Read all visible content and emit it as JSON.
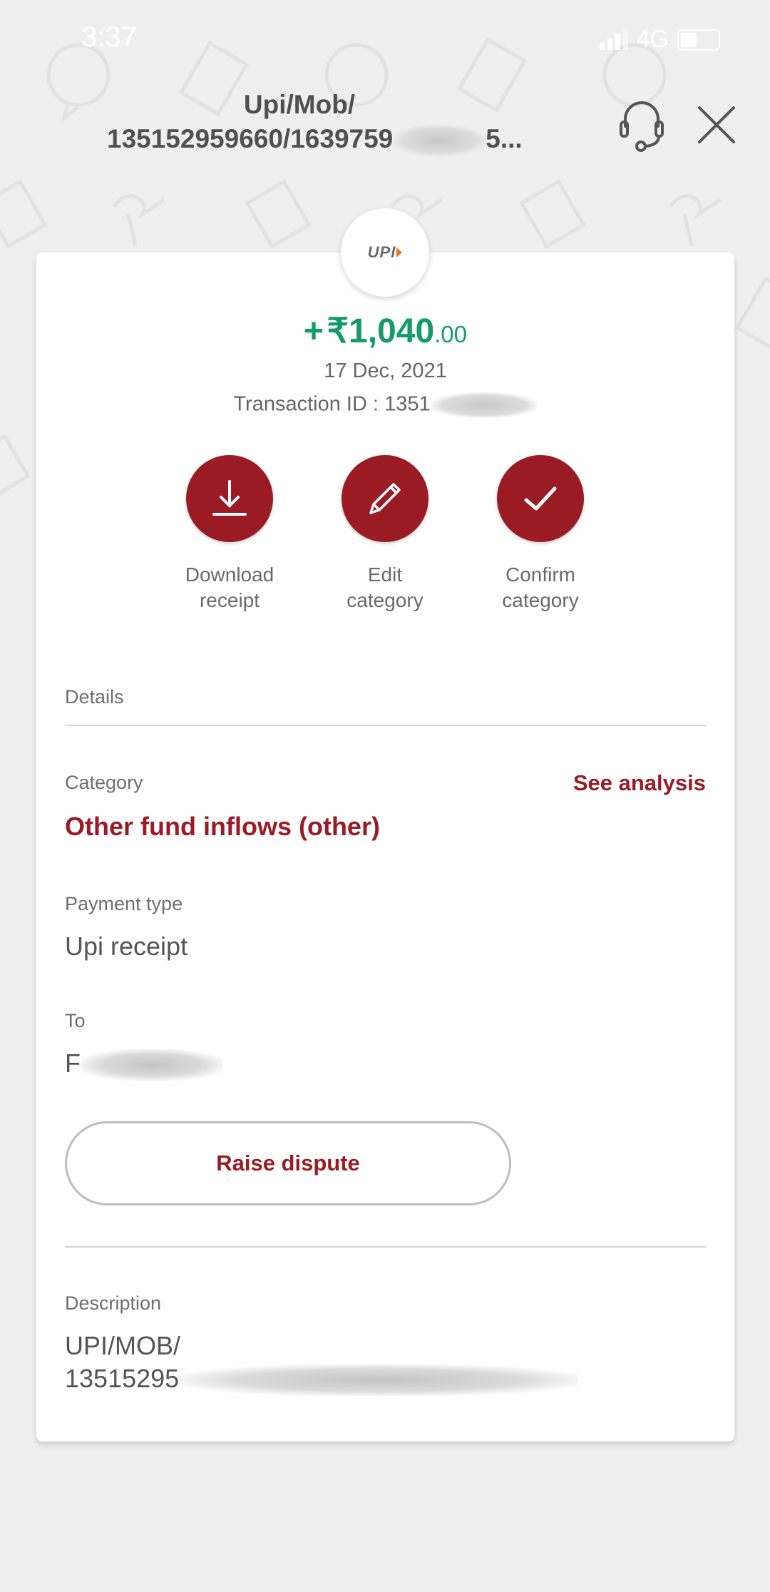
{
  "status_bar": {
    "time": "3:37",
    "network": "4G",
    "battery_level": 0.45
  },
  "header": {
    "title_line1": "Upi/Mob/",
    "title_line2_prefix": "135152959660/1639759",
    "title_line2_suffix": "5...",
    "support_icon": "headset-icon",
    "close_icon": "close-icon"
  },
  "transaction": {
    "logo_text": "UPI",
    "amount_sign": "+",
    "currency": "₹",
    "amount_main": "1,040",
    "amount_decimal": ".00",
    "date": "17 Dec, 2021",
    "transaction_id_label": "Transaction ID : ",
    "transaction_id_visible": "1351"
  },
  "actions": [
    {
      "label_line1": "Download",
      "label_line2": "receipt",
      "icon": "download-icon"
    },
    {
      "label_line1": "Edit",
      "label_line2": "category",
      "icon": "pencil-icon"
    },
    {
      "label_line1": "Confirm",
      "label_line2": "category",
      "icon": "check-icon"
    }
  ],
  "details": {
    "section_title": "Details",
    "category_label": "Category",
    "see_analysis": "See analysis",
    "category_value": "Other fund inflows (other)",
    "payment_type_label": "Payment type",
    "payment_type_value": "Upi receipt",
    "to_label": "To",
    "to_value_visible": "F",
    "raise_dispute": "Raise dispute",
    "description_label": "Description",
    "description_line1": "UPI/MOB/",
    "description_line2_visible": "13515295"
  },
  "colors": {
    "brand_red": "#9b1b25",
    "credit_green": "#159a6e",
    "background": "#efefef"
  }
}
